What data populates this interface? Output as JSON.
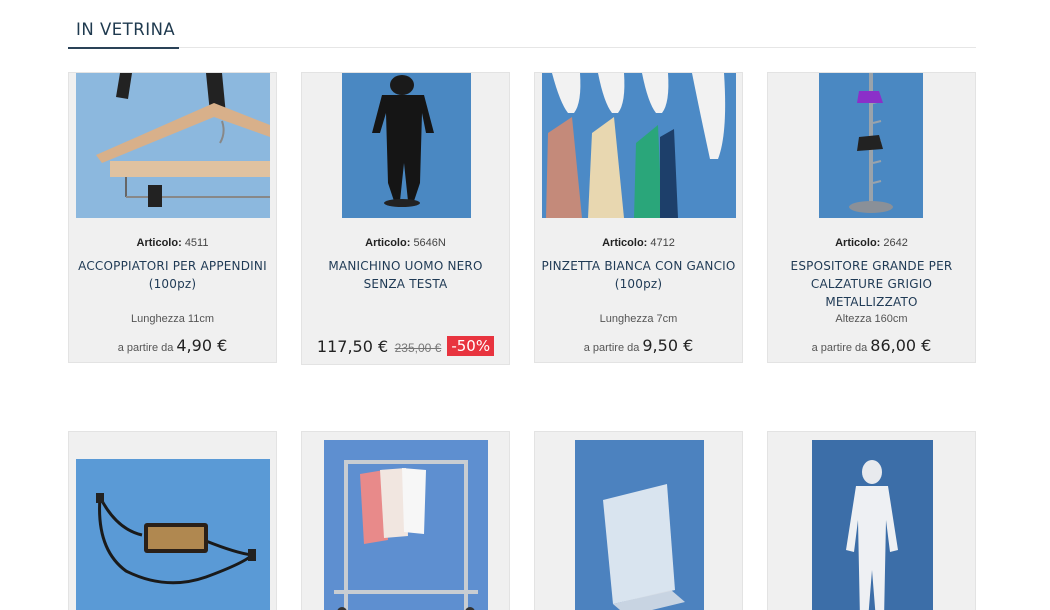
{
  "section": {
    "title": "IN VETRINA"
  },
  "labels": {
    "article": "Articolo:",
    "from": "a partire da"
  },
  "products": [
    {
      "code": "4511",
      "name": "ACCOPPIATORI PER APPENDINI (100pz)",
      "attribute": "Lunghezza 11cm",
      "price": "4,90 €"
    },
    {
      "code": "5646N",
      "name": "MANICHINO UOMO NERO SENZA TESTA",
      "sale_price": "117,50 €",
      "old_price": "235,00 €",
      "discount": "-50%"
    },
    {
      "code": "4712",
      "name": "PINZETTA BIANCA CON GANCIO (100pz)",
      "attribute": "Lunghezza 7cm",
      "price": "9,50 €"
    },
    {
      "code": "2642",
      "name": "ESPOSITORE GRANDE PER CALZATURE GRIGIO METALLIZZATO",
      "attribute": "Altezza 160cm",
      "price": "86,00 €"
    },
    {
      "image": "anti-theft-seal-cord"
    },
    {
      "image": "garment-rack"
    },
    {
      "image": "acrylic-sign-holder"
    },
    {
      "image": "white-female-mannequin"
    }
  ],
  "colors": {
    "accent": "#1f3a55",
    "discount_bg": "#e8343f",
    "card_bg": "#f0f0f0"
  }
}
